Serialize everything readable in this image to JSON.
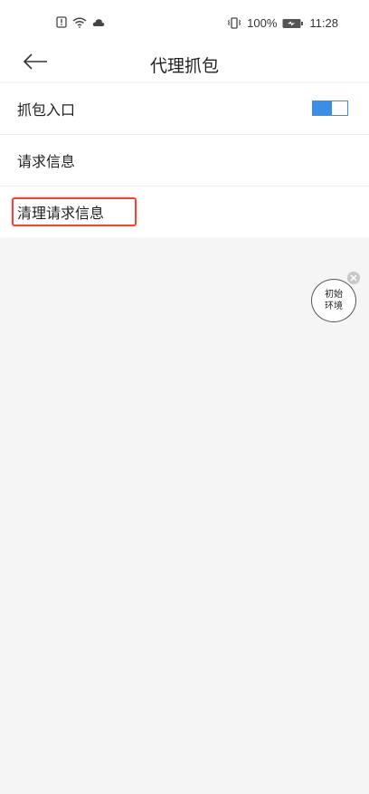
{
  "status_bar": {
    "icons": [
      "notification-icon",
      "wifi-icon",
      "cloud-icon",
      "vibrate-icon",
      "battery-icon"
    ],
    "battery": "100%",
    "time": "11:28"
  },
  "header": {
    "back_icon": "arrow-left-icon",
    "title": "代理抓包"
  },
  "list": {
    "items": [
      {
        "label": "抓包入口",
        "toggle_on": true
      },
      {
        "label": "请求信息"
      },
      {
        "label": "清理请求信息",
        "highlighted": true
      }
    ]
  },
  "floating_env": {
    "line1": "初始",
    "line2": "环境",
    "close_icon": "close-icon"
  },
  "colors": {
    "accent": "#3a8ee6",
    "highlight": "#e04a3f",
    "background": "#f5f5f5"
  }
}
